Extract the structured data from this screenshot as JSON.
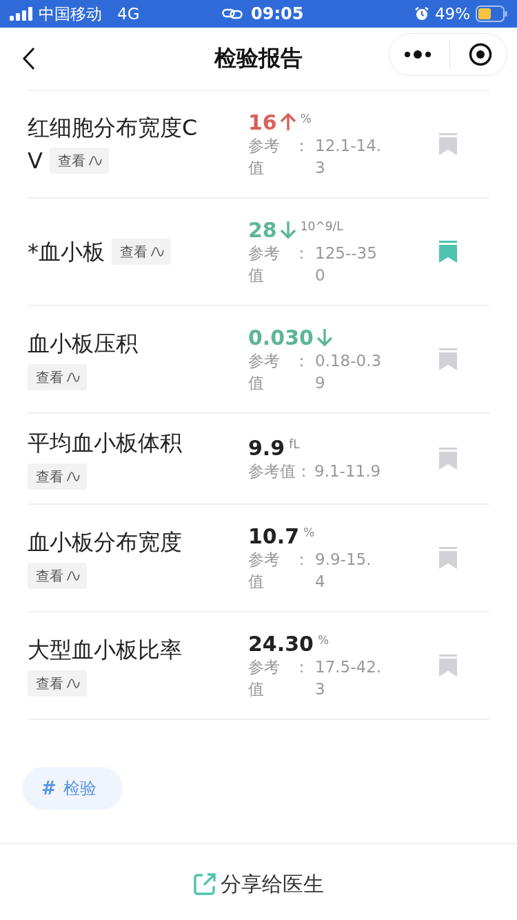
{
  "status_bar": {
    "carrier": "中国移动",
    "network": "4G",
    "time": "09:05",
    "battery": "49%"
  },
  "nav": {
    "title": "检验报告"
  },
  "rows": [
    {
      "name_lines": [
        "红细胞分布宽度C",
        "V"
      ],
      "kind": "inline",
      "view": "查看",
      "value": "16",
      "high": true,
      "low": false,
      "unit": "%",
      "ref_label_lines": [
        "参考",
        "值"
      ],
      "ref_colon": "：",
      "ref_value_lines": [
        "12.1-14.",
        "3"
      ],
      "bookmarked": false
    },
    {
      "name_lines": [
        "*血小板"
      ],
      "kind": "inline",
      "view": "查看",
      "value": "28",
      "high": false,
      "low": true,
      "unit": "10^9/L",
      "ref_label_lines": [
        "参考",
        "值"
      ],
      "ref_colon": "：",
      "ref_value_lines": [
        "125--35",
        "0"
      ],
      "bookmarked": true
    },
    {
      "name_lines": [
        "血小板压积"
      ],
      "kind": "block",
      "view": "查看",
      "value": "0.030",
      "high": false,
      "low": true,
      "ref_label_lines": [
        "参考",
        "值"
      ],
      "ref_colon": "：",
      "ref_value_lines": [
        "0.18-0.3",
        "9"
      ],
      "bookmarked": false
    },
    {
      "name_lines": [
        "平均血小板体积"
      ],
      "kind": "block",
      "view": "查看",
      "value": "9.9",
      "high": false,
      "low": false,
      "unit": "fL",
      "ref_label_lines": [
        "参考值"
      ],
      "ref_colon": "：",
      "ref_value_lines": [
        "9.1-11.9"
      ],
      "bookmarked": false
    },
    {
      "name_lines": [
        "血小板分布宽度"
      ],
      "kind": "block",
      "view": "查看",
      "value": "10.7",
      "high": false,
      "low": false,
      "unit": "%",
      "ref_label_lines": [
        "参考",
        "值"
      ],
      "ref_colon": "：",
      "ref_value_lines": [
        "9.9-15.",
        "4"
      ],
      "bookmarked": false
    },
    {
      "name_lines": [
        "大型血小板比率"
      ],
      "kind": "block",
      "view": "查看",
      "value": "24.30",
      "high": false,
      "low": false,
      "unit": "%",
      "ref_label_lines": [
        "参考",
        "值"
      ],
      "ref_colon": "：",
      "ref_value_lines": [
        "17.5-42.",
        "3"
      ],
      "bookmarked": false
    }
  ],
  "tag": {
    "hash": "#",
    "label": "检验"
  },
  "share": {
    "label": "分享给医生"
  }
}
